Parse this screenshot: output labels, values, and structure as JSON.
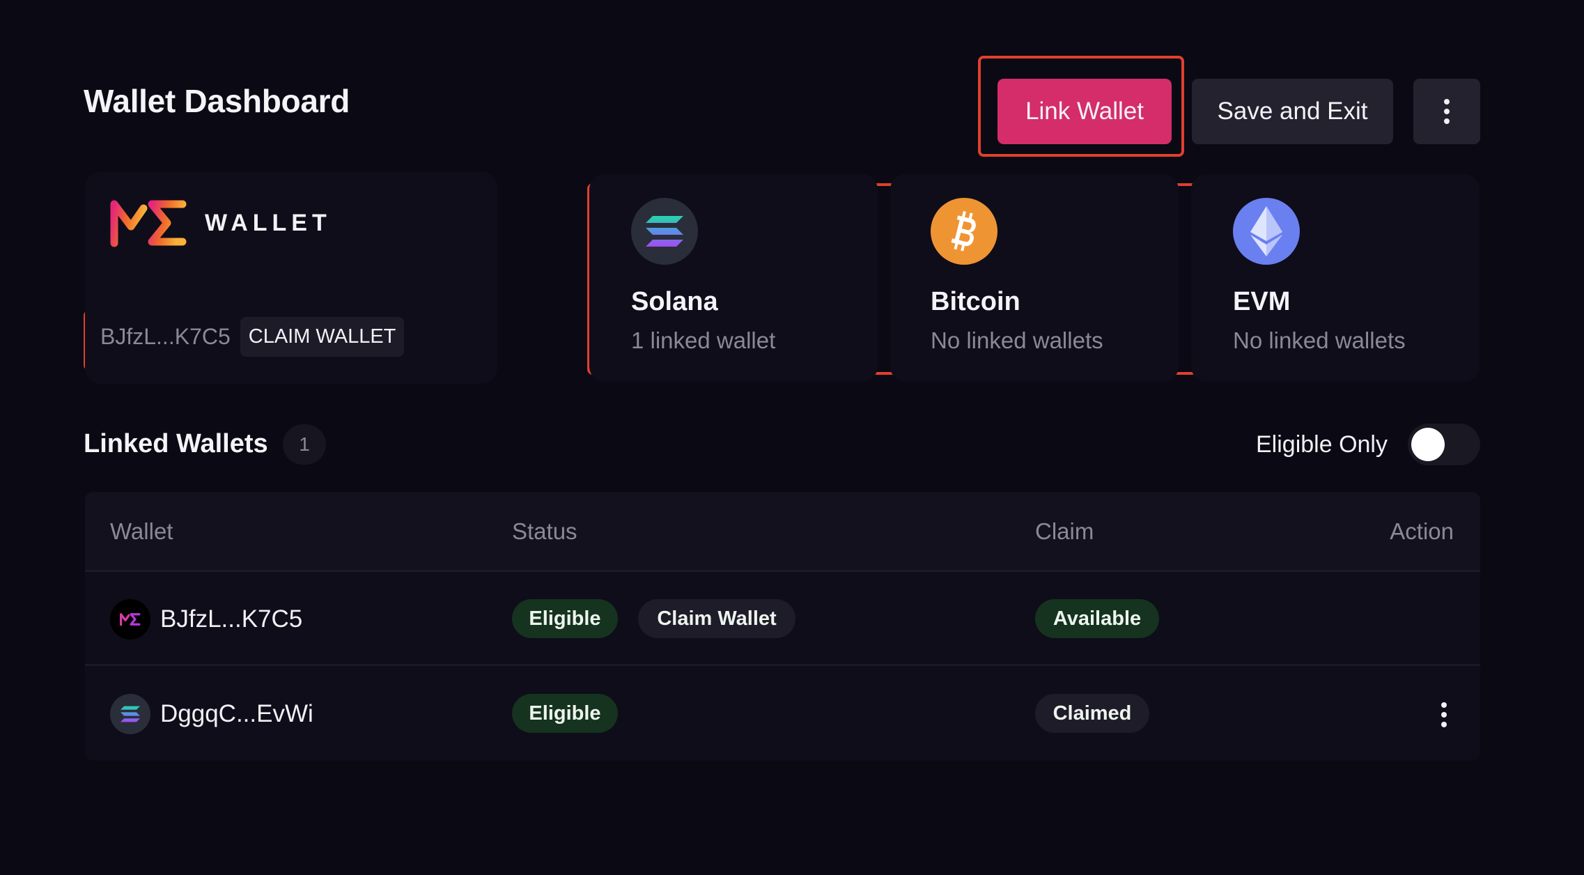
{
  "header": {
    "title": "Wallet Dashboard",
    "link_wallet_label": "Link Wallet",
    "save_exit_label": "Save and Exit",
    "more_icon": "kebab-vertical-icon"
  },
  "me_wallet": {
    "logo_mark": "ME",
    "logo_word": "WALLET",
    "address": "BJfzL...K7C5",
    "claim_label": "CLAIM WALLET"
  },
  "chains": [
    {
      "name": "Solana",
      "subtitle": "1 linked wallet",
      "icon": "solana-icon",
      "color": "#2a2d3a"
    },
    {
      "name": "Bitcoin",
      "subtitle": "No linked wallets",
      "icon": "bitcoin-icon",
      "color": "#ef9433"
    },
    {
      "name": "EVM",
      "subtitle": "No linked wallets",
      "icon": "ethereum-icon",
      "color": "#6a80f0"
    }
  ],
  "linked_wallets": {
    "title": "Linked Wallets",
    "count": "1",
    "filter_label": "Eligible Only",
    "filter_on": false,
    "columns": [
      "Wallet",
      "Status",
      "Claim",
      "Action"
    ],
    "rows": [
      {
        "icon": "magic-eden-icon",
        "address": "BJfzL...K7C5",
        "status": "Eligible",
        "status_action": "Claim Wallet",
        "claim": "Available",
        "action": ""
      },
      {
        "icon": "solana-icon",
        "address": "DggqC...EvWi",
        "status": "Eligible",
        "status_action": "",
        "claim": "Claimed",
        "action": "kebab-vertical-icon"
      }
    ]
  },
  "colors": {
    "accent": "#d42d6a",
    "background": "#0b0913",
    "highlight": "#e0402e",
    "eligible_pill": "#15331f",
    "neutral_pill": "#1e1c28"
  }
}
